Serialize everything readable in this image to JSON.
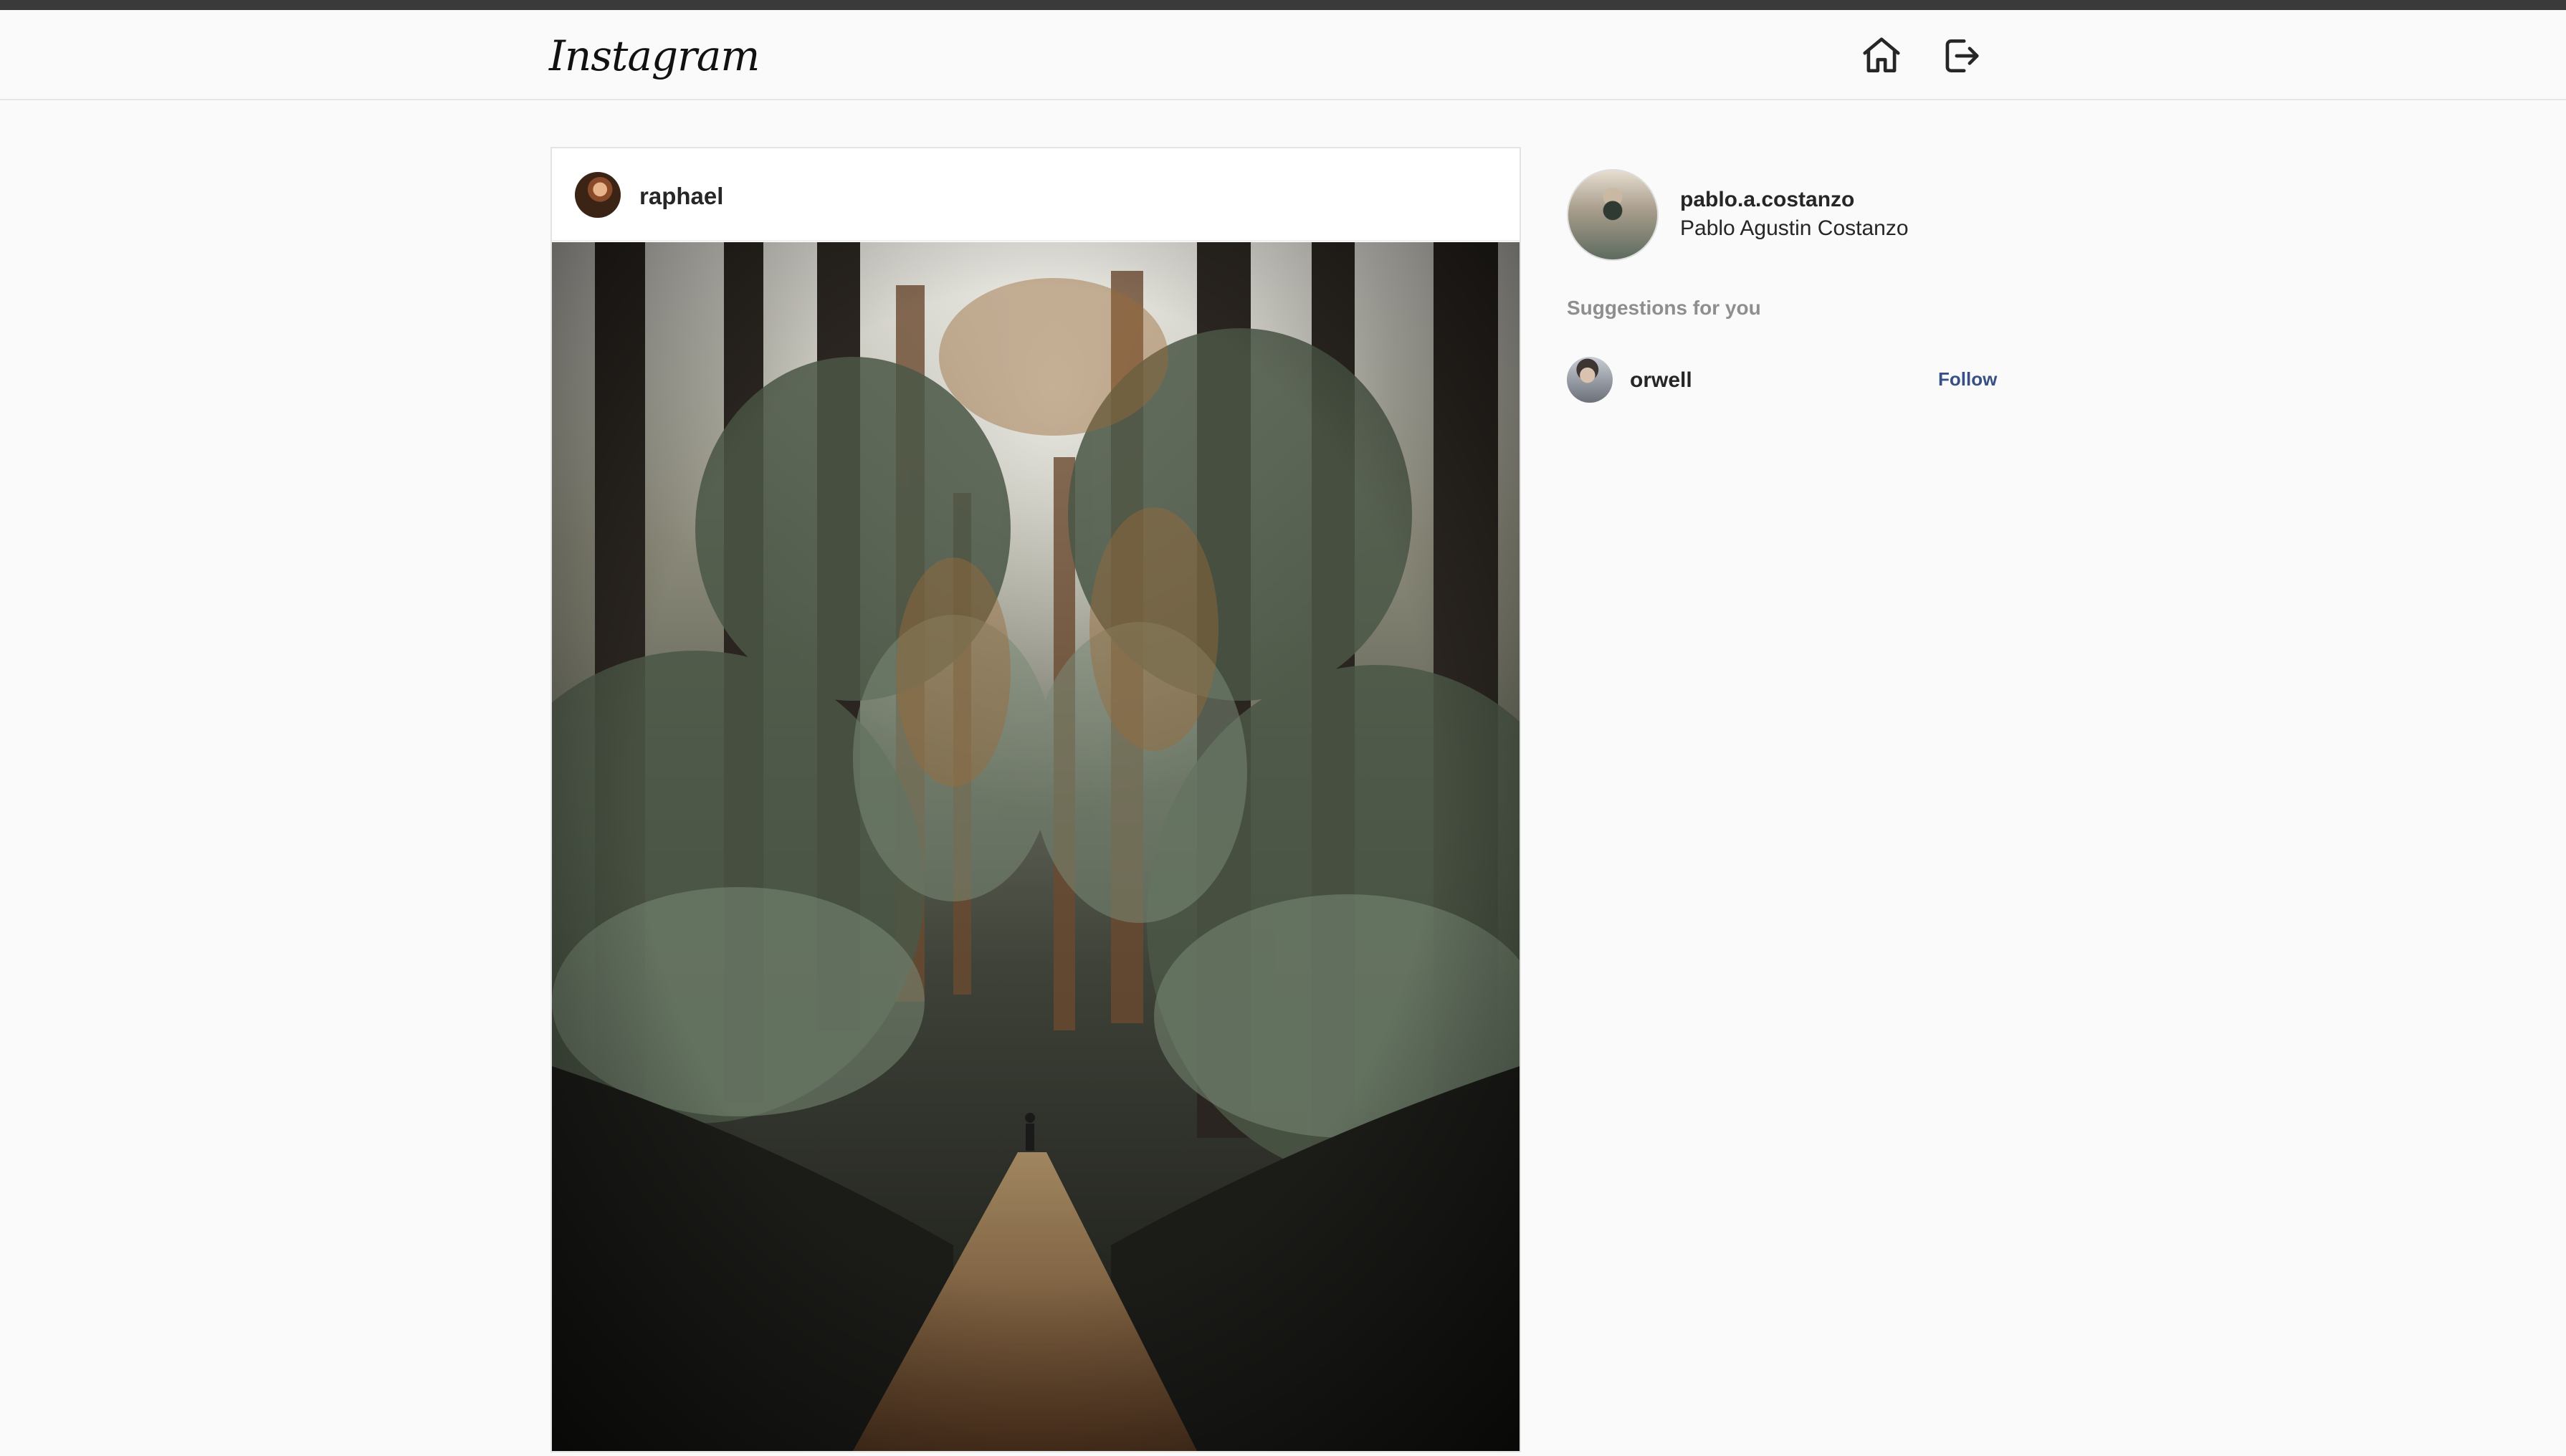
{
  "header": {
    "logo": "Instagram",
    "nav": [
      {
        "icon": "home-icon"
      },
      {
        "icon": "logout-icon"
      }
    ]
  },
  "post": {
    "username": "raphael",
    "image": "forest path with ferns and tall trees"
  },
  "sidebar": {
    "current_user": {
      "username": "pablo.a.costanzo",
      "full_name": "Pablo Agustin Costanzo"
    },
    "suggestions_title": "Suggestions for you",
    "suggestions": [
      {
        "username": "orwell",
        "action": "Follow"
      }
    ]
  },
  "colors": {
    "background": "#fafafa",
    "text": "#262626",
    "muted": "#8e8e8e",
    "follow": "#385185"
  }
}
